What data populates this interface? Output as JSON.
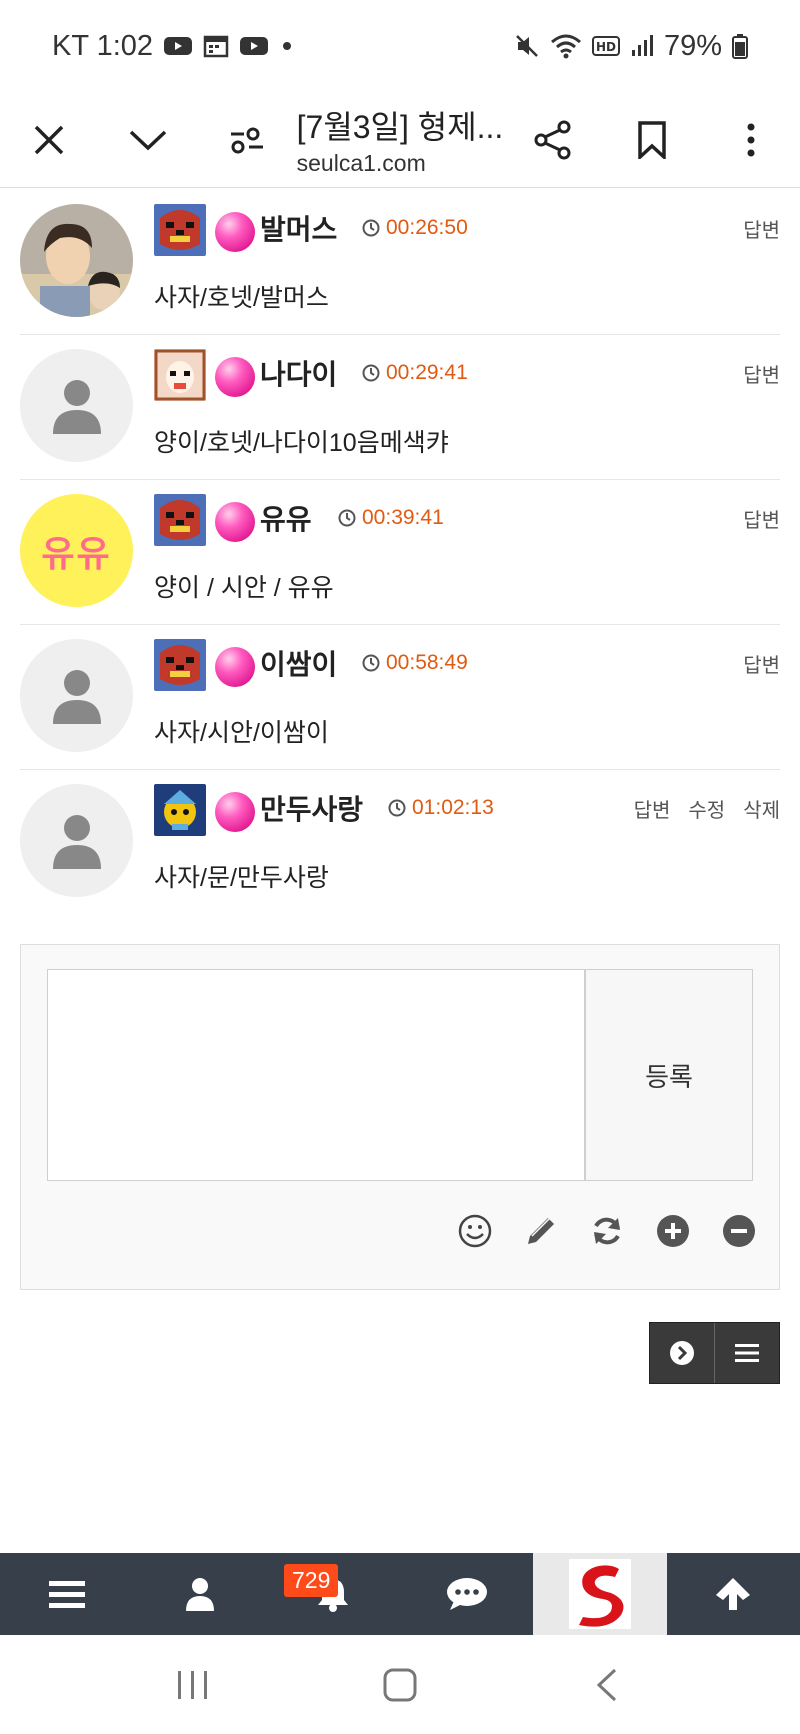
{
  "status_bar": {
    "carrier_time": "KT 1:02",
    "battery": "79%",
    "icons": [
      "youtube-icon",
      "calendar-icon",
      "youtube-icon",
      "dot-icon",
      "mute-icon",
      "wifi-icon",
      "hd-icon",
      "signal-icon",
      "battery-icon"
    ]
  },
  "toolbar": {
    "title": "[7월3일] 형제...",
    "url": "seulca1.com",
    "icons": [
      "close-icon",
      "chevron-down-icon",
      "tune-icon",
      "share-icon",
      "bookmark-icon",
      "more-icon"
    ]
  },
  "comments": [
    {
      "nick": "발머스",
      "time": "00:26:50",
      "text": "사자/호넷/발머스",
      "actions": [
        "답변"
      ],
      "avatar": "photo"
    },
    {
      "nick": "나다이",
      "time": "00:29:41",
      "text": "양이/호넷/나다이10음메색캬",
      "actions": [
        "답변"
      ],
      "avatar": "default"
    },
    {
      "nick": "유유",
      "time": "00:39:41",
      "text": "양이 / 시안 / 유유",
      "actions": [
        "답변"
      ],
      "avatar": "yuyu",
      "avatar_text": "유유"
    },
    {
      "nick": "이쌈이",
      "time": "00:58:49",
      "text": "사자/시안/이쌈이",
      "actions": [
        "답변"
      ],
      "avatar": "default"
    },
    {
      "nick": "만두사랑",
      "time": "01:02:13",
      "text": "사자/문/만두사랑",
      "actions": [
        "답변",
        "수정",
        "삭제"
      ],
      "avatar": "default"
    }
  ],
  "reply": {
    "textarea_value": "",
    "submit_label": "등록",
    "tools": [
      "smile-icon",
      "pencil-icon",
      "refresh-icon",
      "plus-circle-icon",
      "minus-circle-icon"
    ]
  },
  "bottom_nav": {
    "badge_count": "729",
    "items": [
      "menu-icon",
      "user-icon",
      "bell-icon",
      "chat-icon",
      "site-logo",
      "arrow-up-icon"
    ]
  },
  "colors": {
    "time_orange": "#e05a12",
    "nav_bg": "#37404a",
    "badge": "#ff4b1a",
    "pink": "#ff5cc0"
  }
}
